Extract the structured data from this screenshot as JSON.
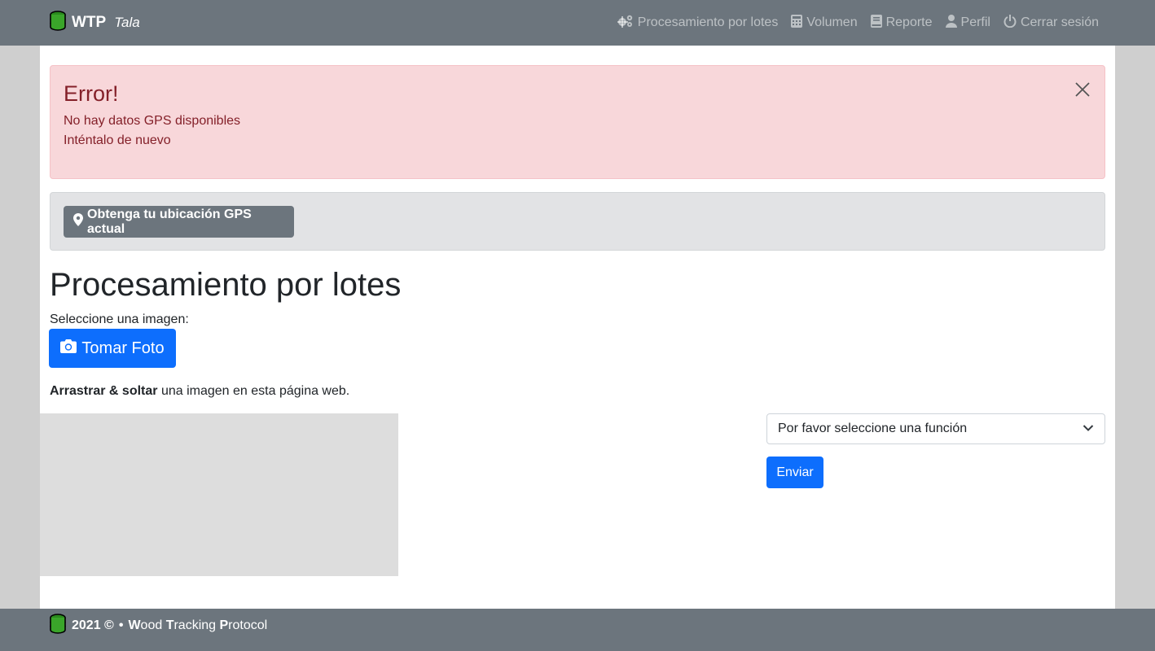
{
  "navbar": {
    "brand": {
      "strong": "WTP",
      "em": "Tala",
      "icon": "database-icon"
    },
    "links": [
      {
        "label": "Procesamiento por lotes",
        "icon": "cogs-icon"
      },
      {
        "label": "Volumen",
        "icon": "calculator-icon"
      },
      {
        "label": "Reporte",
        "icon": "book-icon"
      },
      {
        "label": "Perfil",
        "icon": "user-icon"
      },
      {
        "label": "Cerrar sesión",
        "icon": "power-icon"
      }
    ]
  },
  "alert": {
    "heading": "Error!",
    "line1": "No hay datos GPS disponibles",
    "line2": "Inténtalo de nuevo",
    "close_icon": "close-icon"
  },
  "gps": {
    "button_label": "Obtenga tu ubicación GPS actual",
    "icon": "map-marker-icon"
  },
  "main": {
    "title": "Procesamiento por lotes",
    "select_image_label": "Seleccione una imagen:",
    "photo_button_label": "Tomar Foto",
    "photo_icon": "camera-icon",
    "drag_bold": "Arrastrar & soltar",
    "drag_rest": " una imagen en esta página web.",
    "function_select_value": "Por favor seleccione una función",
    "submit_label": "Enviar"
  },
  "footer": {
    "year": "2021 ©",
    "sep": "•",
    "w": "W",
    "ood": "ood ",
    "t": "T",
    "racking": "racking ",
    "p": "P",
    "rotocol": "rotocol"
  },
  "colors": {
    "navbar_bg": "#6c757d",
    "alert_bg": "#f8d7da",
    "alert_text": "#842029",
    "primary": "#0d6efd",
    "secondary": "#6c757d"
  }
}
